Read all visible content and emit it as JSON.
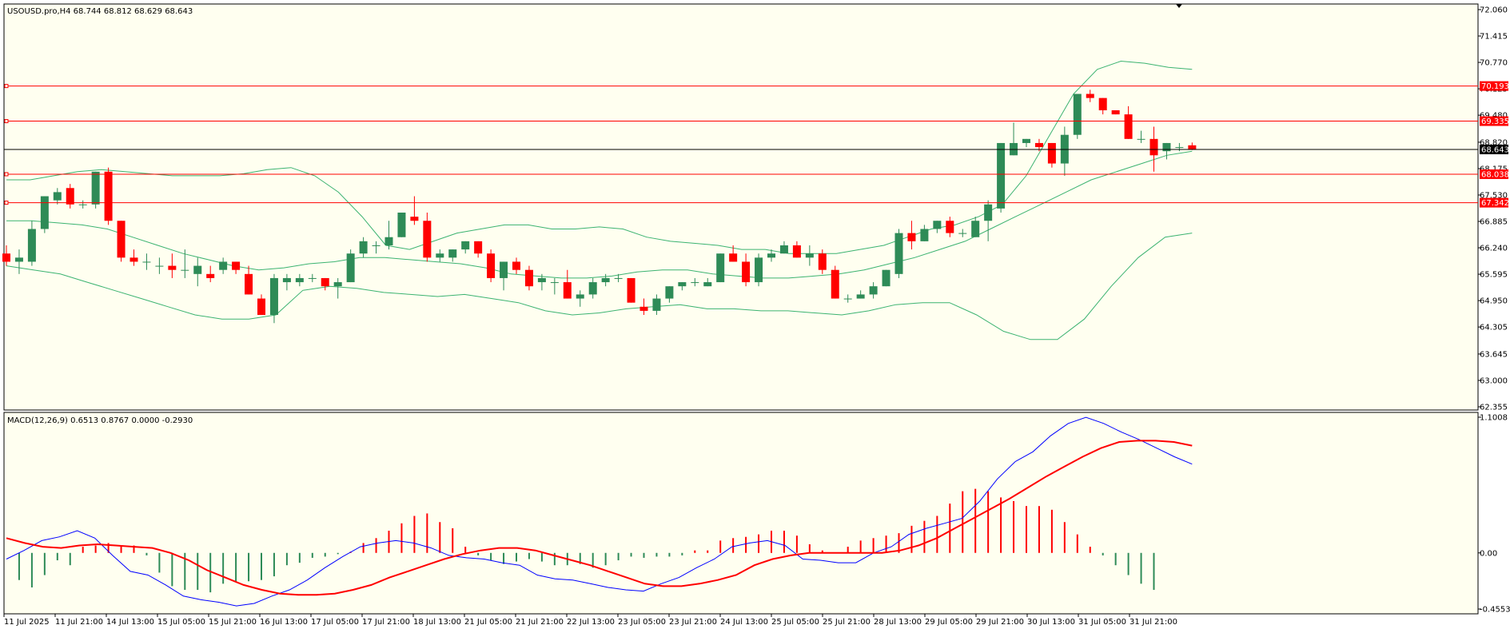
{
  "header": {
    "symbol_line": "USOUSD.pro,H4  68.744 68.812 68.629 68.643",
    "macd_line": "MACD(12,26,9) 0.6513 0.8767 0.0000 -0.2930"
  },
  "colors": {
    "background": "#fffff0",
    "bull": "#2e8b57",
    "bear": "#ff0000",
    "bands": "#3cb371",
    "level": "#ff0000",
    "macd_line": "#0000ff",
    "signal_line": "#ff0000",
    "current_price": "#000000"
  },
  "chart_data": [
    {
      "type": "candlestick",
      "title": "USOUSD.pro,H4",
      "ylim": [
        62.355,
        72.06
      ],
      "y_ticks": [
        "72.060",
        "71.415",
        "70.770",
        "70.125",
        "69.480",
        "68.820",
        "68.175",
        "67.530",
        "66.885",
        "66.240",
        "65.595",
        "64.950",
        "64.305",
        "63.645",
        "63.000",
        "62.355"
      ],
      "x_ticks": [
        "11 Jul 2025",
        "11 Jul 21:00",
        "14 Jul 13:00",
        "15 Jul 05:00",
        "15 Jul 21:00",
        "16 Jul 13:00",
        "17 Jul 05:00",
        "17 Jul 21:00",
        "18 Jul 13:00",
        "21 Jul 05:00",
        "21 Jul 21:00",
        "22 Jul 13:00",
        "23 Jul 05:00",
        "23 Jul 21:00",
        "24 Jul 13:00",
        "25 Jul 05:00",
        "25 Jul 21:00",
        "28 Jul 13:00",
        "29 Jul 05:00",
        "29 Jul 21:00",
        "30 Jul 13:00",
        "31 Jul 05:00",
        "31 Jul 21:00"
      ],
      "levels": [
        70.193,
        69.335,
        68.038,
        67.342
      ],
      "level_labels": [
        "70.193",
        "69.335",
        "68.038",
        "67.342"
      ],
      "current_price": 68.643,
      "current_price_label": "68.643",
      "ohlc": [
        [
          66.1,
          66.3,
          65.8,
          65.9
        ],
        [
          65.9,
          66.2,
          65.6,
          66.0
        ],
        [
          65.9,
          66.9,
          65.8,
          66.7
        ],
        [
          66.7,
          67.5,
          66.6,
          67.5
        ],
        [
          67.4,
          67.7,
          67.3,
          67.6
        ],
        [
          67.7,
          67.8,
          67.2,
          67.3
        ],
        [
          67.3,
          67.4,
          67.2,
          67.3
        ],
        [
          67.3,
          68.1,
          67.2,
          68.1
        ],
        [
          68.1,
          68.2,
          66.8,
          66.9
        ],
        [
          66.9,
          66.9,
          65.9,
          66.0
        ],
        [
          66.0,
          66.2,
          65.8,
          65.9
        ],
        [
          65.9,
          66.1,
          65.7,
          65.9
        ],
        [
          65.8,
          66.0,
          65.6,
          65.8
        ],
        [
          65.8,
          66.1,
          65.5,
          65.7
        ],
        [
          65.7,
          66.2,
          65.5,
          65.7
        ],
        [
          65.6,
          66.0,
          65.3,
          65.8
        ],
        [
          65.6,
          65.8,
          65.4,
          65.5
        ],
        [
          65.7,
          66.0,
          65.6,
          65.9
        ],
        [
          65.9,
          65.9,
          65.6,
          65.7
        ],
        [
          65.6,
          65.8,
          65.1,
          65.1
        ],
        [
          65.0,
          65.1,
          64.6,
          64.6
        ],
        [
          64.6,
          65.6,
          64.4,
          65.5
        ],
        [
          65.4,
          65.6,
          65.2,
          65.5
        ],
        [
          65.4,
          65.6,
          65.3,
          65.5
        ],
        [
          65.5,
          65.6,
          65.4,
          65.5
        ],
        [
          65.5,
          65.5,
          65.2,
          65.3
        ],
        [
          65.3,
          65.5,
          65.0,
          65.4
        ],
        [
          65.4,
          66.2,
          65.4,
          66.1
        ],
        [
          66.1,
          66.5,
          66.0,
          66.4
        ],
        [
          66.3,
          66.4,
          66.1,
          66.3
        ],
        [
          66.3,
          66.9,
          66.2,
          66.5
        ],
        [
          66.5,
          67.1,
          66.5,
          67.1
        ],
        [
          67.0,
          67.5,
          66.8,
          66.9
        ],
        [
          66.9,
          67.1,
          65.9,
          66.0
        ],
        [
          66.0,
          66.2,
          65.9,
          66.1
        ],
        [
          66.0,
          66.2,
          65.9,
          66.2
        ],
        [
          66.2,
          66.4,
          66.1,
          66.4
        ],
        [
          66.4,
          66.4,
          66.0,
          66.1
        ],
        [
          66.1,
          66.2,
          65.4,
          65.5
        ],
        [
          65.5,
          65.9,
          65.2,
          65.9
        ],
        [
          65.9,
          66.0,
          65.6,
          65.7
        ],
        [
          65.7,
          65.8,
          65.2,
          65.3
        ],
        [
          65.4,
          65.6,
          65.2,
          65.5
        ],
        [
          65.4,
          65.5,
          65.1,
          65.4
        ],
        [
          65.4,
          65.7,
          65.0,
          65.0
        ],
        [
          65.0,
          65.2,
          64.8,
          65.1
        ],
        [
          65.1,
          65.5,
          65.0,
          65.4
        ],
        [
          65.4,
          65.6,
          65.3,
          65.5
        ],
        [
          65.5,
          65.6,
          65.4,
          65.5
        ],
        [
          65.5,
          65.5,
          64.9,
          64.9
        ],
        [
          64.8,
          65.0,
          64.6,
          64.7
        ],
        [
          64.7,
          65.1,
          64.6,
          65.0
        ],
        [
          65.0,
          65.3,
          64.9,
          65.3
        ],
        [
          65.3,
          65.4,
          65.2,
          65.4
        ],
        [
          65.4,
          65.5,
          65.3,
          65.4
        ],
        [
          65.3,
          65.5,
          65.3,
          65.4
        ],
        [
          65.4,
          66.1,
          65.4,
          66.1
        ],
        [
          66.1,
          66.3,
          65.9,
          65.9
        ],
        [
          65.9,
          66.1,
          65.3,
          65.4
        ],
        [
          65.4,
          66.1,
          65.3,
          66.0
        ],
        [
          66.0,
          66.2,
          65.9,
          66.1
        ],
        [
          66.1,
          66.4,
          66.1,
          66.3
        ],
        [
          66.3,
          66.4,
          66.0,
          66.0
        ],
        [
          66.0,
          66.3,
          65.8,
          66.1
        ],
        [
          66.1,
          66.2,
          65.6,
          65.7
        ],
        [
          65.7,
          65.8,
          65.0,
          65.0
        ],
        [
          65.0,
          65.1,
          64.9,
          65.0
        ],
        [
          65.0,
          65.2,
          65.0,
          65.1
        ],
        [
          65.1,
          65.4,
          65.0,
          65.3
        ],
        [
          65.3,
          65.7,
          65.3,
          65.7
        ],
        [
          65.6,
          66.7,
          65.5,
          66.6
        ],
        [
          66.6,
          66.9,
          66.2,
          66.4
        ],
        [
          66.4,
          66.8,
          66.4,
          66.7
        ],
        [
          66.7,
          66.9,
          66.6,
          66.9
        ],
        [
          66.9,
          67.0,
          66.5,
          66.6
        ],
        [
          66.6,
          66.7,
          66.5,
          66.6
        ],
        [
          66.5,
          67.0,
          66.5,
          66.9
        ],
        [
          66.9,
          67.4,
          66.4,
          67.3
        ],
        [
          67.2,
          68.8,
          67.1,
          68.8
        ],
        [
          68.5,
          69.3,
          68.5,
          68.8
        ],
        [
          68.8,
          68.9,
          68.7,
          68.9
        ],
        [
          68.8,
          68.9,
          68.6,
          68.7
        ],
        [
          68.8,
          68.8,
          68.2,
          68.3
        ],
        [
          68.3,
          69.2,
          68.0,
          69.0
        ],
        [
          69.0,
          70.0,
          68.9,
          70.0
        ],
        [
          70.0,
          70.1,
          69.8,
          69.9
        ],
        [
          69.9,
          69.9,
          69.5,
          69.6
        ],
        [
          69.6,
          69.6,
          69.5,
          69.5
        ],
        [
          69.5,
          69.7,
          68.9,
          68.9
        ],
        [
          68.9,
          69.1,
          68.8,
          68.9
        ],
        [
          68.9,
          69.2,
          68.1,
          68.5
        ],
        [
          68.6,
          68.8,
          68.4,
          68.8
        ],
        [
          68.7,
          68.8,
          68.6,
          68.7
        ],
        [
          68.744,
          68.812,
          68.629,
          68.643
        ]
      ],
      "bands_upper": [
        67.9,
        67.9,
        68.0,
        68.1,
        68.15,
        68.1,
        68.05,
        68.0,
        68.0,
        68.0,
        68.05,
        68.15,
        68.2,
        68.0,
        67.6,
        67.0,
        66.3,
        66.2,
        66.4,
        66.6,
        66.7,
        66.8,
        66.8,
        66.7,
        66.7,
        66.75,
        66.7,
        66.5,
        66.4,
        66.35,
        66.3,
        66.2,
        66.2,
        66.1,
        66.1,
        66.1,
        66.2,
        66.3,
        66.5,
        66.7,
        66.8,
        67.0,
        67.3,
        68.0,
        69.0,
        70.0,
        70.6,
        70.8,
        70.75,
        70.65,
        70.6
      ],
      "bands_middle": [
        66.9,
        66.9,
        66.85,
        66.8,
        66.7,
        66.5,
        66.3,
        66.1,
        65.95,
        65.8,
        65.7,
        65.75,
        65.85,
        65.9,
        66.0,
        66.0,
        65.95,
        65.9,
        65.85,
        65.75,
        65.6,
        65.55,
        65.5,
        65.5,
        65.55,
        65.65,
        65.7,
        65.7,
        65.6,
        65.55,
        65.5,
        65.5,
        65.55,
        65.6,
        65.7,
        65.85,
        66.0,
        66.2,
        66.4,
        66.7,
        67.0,
        67.3,
        67.6,
        67.9,
        68.1,
        68.3,
        68.5,
        68.6
      ],
      "bands_lower": [
        65.8,
        65.7,
        65.6,
        65.4,
        65.2,
        65.0,
        64.8,
        64.6,
        64.5,
        64.5,
        64.6,
        65.2,
        65.3,
        65.25,
        65.15,
        65.1,
        65.05,
        65.1,
        65.0,
        64.9,
        64.7,
        64.6,
        64.65,
        64.75,
        64.8,
        64.85,
        64.75,
        64.75,
        64.7,
        64.7,
        64.65,
        64.6,
        64.7,
        64.85,
        64.9,
        64.9,
        64.6,
        64.2,
        64.0,
        64.0,
        64.5,
        65.3,
        66.0,
        66.5,
        66.6
      ]
    },
    {
      "type": "macd",
      "title": "MACD(12,26,9)",
      "ylim": [
        -0.4553,
        1.1008
      ],
      "y_ticks": [
        "1.1008",
        "0.00",
        "-0.4553"
      ],
      "histogram": [
        -0.22,
        -0.28,
        -0.18,
        -0.06,
        -0.1,
        0.05,
        0.06,
        0.08,
        0.06,
        0.06,
        -0.02,
        -0.16,
        -0.27,
        -0.3,
        -0.3,
        -0.32,
        -0.25,
        -0.23,
        -0.23,
        -0.22,
        -0.19,
        -0.1,
        -0.08,
        -0.04,
        -0.03,
        -0.01,
        0.01,
        0.08,
        0.12,
        0.18,
        0.24,
        0.3,
        0.32,
        0.25,
        0.2,
        0.05,
        -0.02,
        -0.06,
        -0.09,
        -0.07,
        -0.05,
        -0.07,
        -0.1,
        -0.1,
        -0.09,
        -0.12,
        -0.1,
        -0.06,
        -0.03,
        -0.04,
        -0.03,
        -0.03,
        -0.02,
        0.02,
        0.02,
        0.1,
        0.12,
        0.13,
        0.15,
        0.18,
        0.18,
        0.14,
        0.07,
        0.02,
        0.0,
        0.05,
        0.1,
        0.12,
        0.14,
        0.16,
        0.22,
        0.26,
        0.3,
        0.4,
        0.5,
        0.52,
        0.5,
        0.45,
        0.42,
        0.38,
        0.38,
        0.35,
        0.25,
        0.15,
        0.05,
        -0.02,
        -0.1,
        -0.18,
        -0.25,
        -0.3
      ],
      "macd": [
        -0.05,
        0.02,
        0.1,
        0.13,
        0.18,
        0.12,
        -0.02,
        -0.15,
        -0.18,
        -0.26,
        -0.35,
        -0.38,
        -0.4,
        -0.43,
        -0.41,
        -0.35,
        -0.3,
        -0.22,
        -0.12,
        -0.03,
        0.05,
        0.08,
        0.1,
        0.08,
        0.04,
        -0.02,
        -0.04,
        -0.05,
        -0.08,
        -0.1,
        -0.18,
        -0.21,
        -0.22,
        -0.25,
        -0.28,
        -0.3,
        -0.31,
        -0.25,
        -0.2,
        -0.12,
        -0.05,
        0.05,
        0.08,
        0.1,
        0.06,
        -0.05,
        -0.06,
        -0.08,
        -0.08,
        0.0,
        0.05,
        0.15,
        0.2,
        0.24,
        0.28,
        0.42,
        0.6,
        0.74,
        0.82,
        0.95,
        1.05,
        1.1,
        1.05,
        0.98,
        0.92,
        0.85,
        0.78,
        0.72
      ],
      "signal": [
        0.12,
        0.08,
        0.05,
        0.04,
        0.06,
        0.07,
        0.06,
        0.05,
        0.04,
        0.0,
        -0.06,
        -0.14,
        -0.2,
        -0.26,
        -0.3,
        -0.33,
        -0.34,
        -0.34,
        -0.33,
        -0.3,
        -0.26,
        -0.2,
        -0.15,
        -0.1,
        -0.05,
        -0.01,
        0.02,
        0.04,
        0.04,
        0.02,
        -0.02,
        -0.06,
        -0.1,
        -0.15,
        -0.2,
        -0.25,
        -0.27,
        -0.27,
        -0.25,
        -0.22,
        -0.18,
        -0.1,
        -0.05,
        -0.02,
        0.0,
        0.0,
        0.0,
        0.0,
        0.0,
        0.02,
        0.06,
        0.12,
        0.2,
        0.28,
        0.36,
        0.44,
        0.53,
        0.62,
        0.7,
        0.78,
        0.85,
        0.9,
        0.91,
        0.91,
        0.9,
        0.87
      ]
    }
  ]
}
